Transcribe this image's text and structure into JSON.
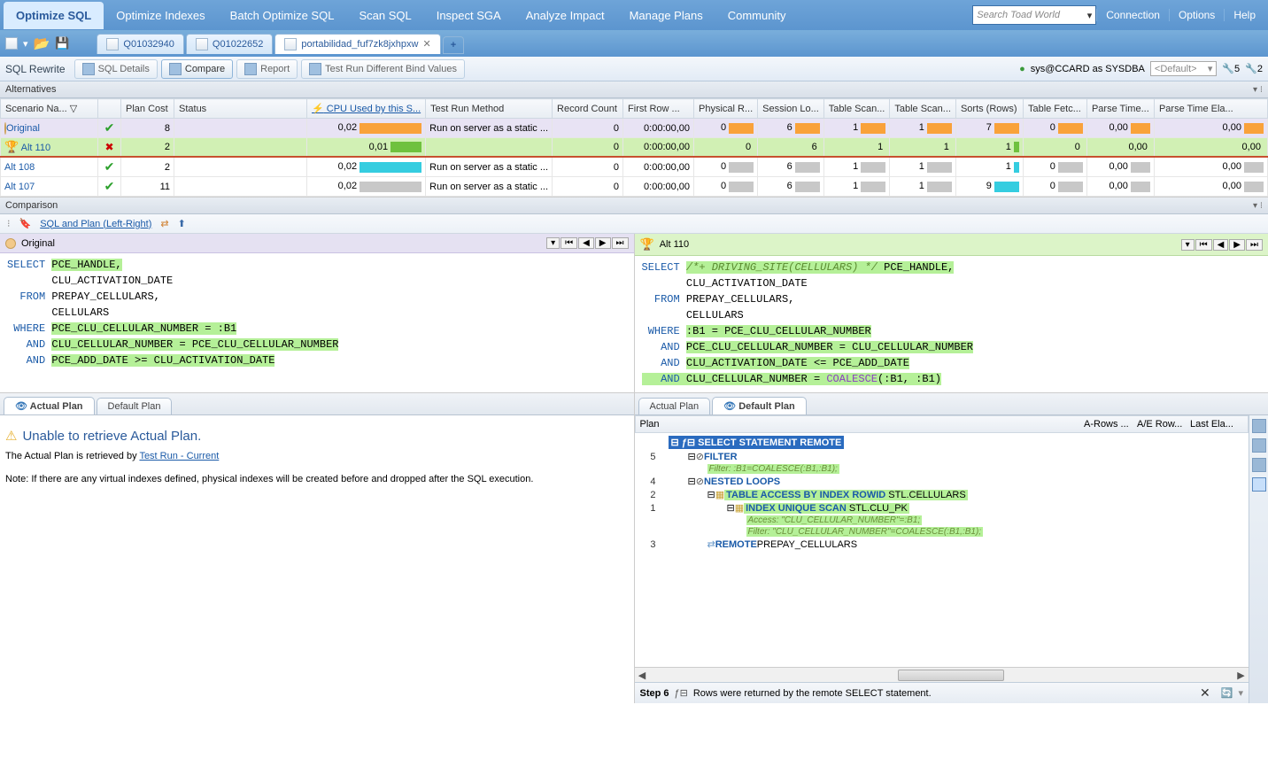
{
  "topMenu": {
    "items": [
      "Optimize SQL",
      "Optimize Indexes",
      "Batch Optimize SQL",
      "Scan SQL",
      "Inspect SGA",
      "Analyze Impact",
      "Manage Plans",
      "Community"
    ],
    "activeIndex": 0,
    "searchPlaceholder": "Search Toad World",
    "rightLinks": [
      "Connection",
      "Options",
      "Help"
    ]
  },
  "docTabs": {
    "tabs": [
      {
        "label": "Q01032940",
        "active": false
      },
      {
        "label": "Q01022652",
        "active": false
      },
      {
        "label": "portabilidad_fuf7zk8jxhpxw",
        "active": true
      }
    ]
  },
  "secondBar": {
    "title": "SQL Rewrite",
    "buttons": [
      {
        "label": "SQL Details",
        "active": false
      },
      {
        "label": "Compare",
        "active": true
      },
      {
        "label": "Report",
        "active": false
      },
      {
        "label": "Test Run Different Bind Values",
        "active": false
      }
    ],
    "connection": "sys@CCARD as SYSDBA",
    "defaultLabel": "<Default>",
    "counters": [
      {
        "v": "5"
      },
      {
        "v": "2"
      }
    ]
  },
  "alternatives": {
    "title": "Alternatives",
    "columns": [
      "Scenario Na... ▽",
      "",
      "Plan Cost",
      "Status",
      "CPU Used by this S...",
      "Test Run Method",
      "Record Count",
      "First Row ...",
      "Physical R...",
      "Session Lo...",
      "Table Scan...",
      "Table Scan...",
      "Sorts (Rows)",
      "Table Fetc...",
      "Parse Time...",
      "Parse Time Ela..."
    ],
    "sortCol": 4,
    "rows": [
      {
        "icon": "person",
        "name": "Original",
        "status": "ok",
        "cost": "8",
        "cpu": "0,02",
        "cpuBar": "orange",
        "cpuW": 70,
        "method": "Run on server as a static ...",
        "rec": "0",
        "first": "0:00:00,00",
        "phys": "0",
        "physBar": "orange",
        "physW": 28,
        "sess": "6",
        "sessBar": "orange",
        "sessW": 28,
        "ts1": "1",
        "ts1Bar": "orange",
        "ts1W": 28,
        "ts2": "1",
        "ts2Bar": "orange",
        "ts2W": 28,
        "sorts": "7",
        "sortsBar": "orange",
        "sortsW": 28,
        "fetch": "0",
        "fetchBar": "orange",
        "fetchW": 28,
        "pt1": "0,00",
        "pt1Bar": "orange",
        "pt1W": 22,
        "pt2": "0,00",
        "pt2Bar": "orange",
        "pt2W": 22,
        "cls": "highlight-purple"
      },
      {
        "icon": "trophy",
        "name": "Alt 110",
        "status": "x",
        "cost": "2",
        "cpu": "0,01",
        "cpuBar": "green",
        "cpuW": 35,
        "method": "",
        "rec": "0",
        "first": "0:00:00,00",
        "phys": "0",
        "physBar": "",
        "physW": 0,
        "sess": "6",
        "sessBar": "",
        "sessW": 0,
        "ts1": "1",
        "ts1Bar": "",
        "ts1W": 0,
        "ts2": "1",
        "ts2Bar": "",
        "ts2W": 0,
        "sorts": "1",
        "sortsBar": "green",
        "sortsW": 6,
        "fetch": "0",
        "fetchBar": "",
        "fetchW": 0,
        "pt1": "0,00",
        "pt1Bar": "",
        "pt1W": 0,
        "pt2": "0,00",
        "pt2Bar": "",
        "pt2W": 0,
        "cls": "highlight-green sel-line"
      },
      {
        "icon": "",
        "name": "Alt 108",
        "status": "ok",
        "cost": "2",
        "cpu": "0,02",
        "cpuBar": "cyan",
        "cpuW": 70,
        "method": "Run on server as a static ...",
        "rec": "0",
        "first": "0:00:00,00",
        "phys": "0",
        "physBar": "gray",
        "physW": 28,
        "sess": "6",
        "sessBar": "gray",
        "sessW": 28,
        "ts1": "1",
        "ts1Bar": "gray",
        "ts1W": 28,
        "ts2": "1",
        "ts2Bar": "gray",
        "ts2W": 28,
        "sorts": "1",
        "sortsBar": "cyan",
        "sortsW": 6,
        "fetch": "0",
        "fetchBar": "gray",
        "fetchW": 28,
        "pt1": "0,00",
        "pt1Bar": "gray",
        "pt1W": 22,
        "pt2": "0,00",
        "pt2Bar": "gray",
        "pt2W": 22,
        "cls": ""
      },
      {
        "icon": "",
        "name": "Alt 107",
        "status": "ok",
        "cost": "11",
        "cpu": "0,02",
        "cpuBar": "gray",
        "cpuW": 70,
        "method": "Run on server as a static ...",
        "rec": "0",
        "first": "0:00:00,00",
        "phys": "0",
        "physBar": "gray",
        "physW": 28,
        "sess": "6",
        "sessBar": "gray",
        "sessW": 28,
        "ts1": "1",
        "ts1Bar": "gray",
        "ts1W": 28,
        "ts2": "1",
        "ts2Bar": "gray",
        "ts2W": 28,
        "sorts": "9",
        "sortsBar": "cyan",
        "sortsW": 28,
        "fetch": "0",
        "fetchBar": "gray",
        "fetchW": 28,
        "pt1": "0,00",
        "pt1Bar": "gray",
        "pt1W": 22,
        "pt2": "0,00",
        "pt2Bar": "gray",
        "pt2W": 22,
        "cls": ""
      }
    ]
  },
  "comparison": {
    "title": "Comparison",
    "toolbarLink": "SQL and Plan (Left-Right)",
    "left": {
      "title": "Original",
      "sql": {
        "l1p1": "SELECT ",
        "l1hl": "PCE_HANDLE,",
        "l2": "       CLU_ACTIVATION_DATE",
        "l3": "  FROM PREPAY_CELLULARS,",
        "l4": "       CELLULARS",
        "l5w": " WHERE ",
        "l5hl": "PCE_CLU_CELLULAR_NUMBER = :B1",
        "l6a": "   AND ",
        "l6hl": "CLU_CELLULAR_NUMBER = PCE_CLU_CELLULAR_NUMBER",
        "l7a": "   AND ",
        "l7hl": "PCE_ADD_DATE >= CLU_ACTIVATION_DATE"
      }
    },
    "right": {
      "title": "Alt 110",
      "sql": {
        "l1p1": "SELECT ",
        "l1c": "/*+ DRIVING_SITE(CELLULARS) */",
        "l1hl": " PCE_HANDLE,",
        "l2": "       CLU_ACTIVATION_DATE",
        "l3": "  FROM PREPAY_CELLULARS,",
        "l4": "       CELLULARS",
        "l5w": " WHERE ",
        "l5hl": ":B1 = PCE_CLU_CELLULAR_NUMBER",
        "l6a": "   AND ",
        "l6hl": "PCE_CLU_CELLULAR_NUMBER = CLU_CELLULAR_NUMBER",
        "l7a": "   AND ",
        "l7hl": "CLU_ACTIVATION_DATE <= PCE_ADD_DATE",
        "l8a": "   AND ",
        "l8t": "CLU_CELLULAR_NUMBER = ",
        "l8f": "COALESCE",
        "l8r": "(:B1, :B1)"
      }
    }
  },
  "plans": {
    "left": {
      "tabs": [
        "Actual Plan",
        "Default Plan"
      ],
      "activeTab": 0,
      "warning": "Unable to retrieve Actual Plan.",
      "line1a": "The Actual Plan is retrieved by ",
      "line1link": "Test Run - Current",
      "line2": "Note: If there are any virtual indexes defined, physical indexes will be created before and dropped after the SQL execution."
    },
    "right": {
      "tabs": [
        "Actual Plan",
        "Default Plan"
      ],
      "activeTab": 1,
      "headCols": [
        "Plan",
        "A-Rows ...",
        "A/E Row...",
        "Last Ela..."
      ],
      "tree": [
        {
          "n": "",
          "ind": 0,
          "type": "sel",
          "text": "SELECT STATEMENT REMOTE"
        },
        {
          "n": "5",
          "ind": 1,
          "type": "bold",
          "text": "FILTER"
        },
        {
          "n": "",
          "ind": 2,
          "type": "annot",
          "text": "Filter: :B1=COALESCE(:B1,:B1);"
        },
        {
          "n": "4",
          "ind": 1,
          "type": "bold",
          "text": "NESTED LOOPS"
        },
        {
          "n": "2",
          "ind": 2,
          "type": "green",
          "bold": "TABLE ACCESS BY INDEX ROWID",
          "rest": " STL.CELLULARS"
        },
        {
          "n": "1",
          "ind": 3,
          "type": "green",
          "bold": "INDEX UNIQUE SCAN",
          "rest": " STL.CLU_PK"
        },
        {
          "n": "",
          "ind": 4,
          "type": "annot",
          "text": "Access: \"CLU_CELLULAR_NUMBER\"=:B1;"
        },
        {
          "n": "",
          "ind": 4,
          "type": "annot",
          "text": "Filter: \"CLU_CELLULAR_NUMBER\"=COALESCE(:B1,:B1);"
        },
        {
          "n": "3",
          "ind": 2,
          "type": "plain",
          "bold": "REMOTE",
          "rest": " PREPAY_CELLULARS"
        }
      ],
      "footer": {
        "step": "Step 6",
        "text": "Rows were returned by the remote SELECT statement."
      }
    }
  }
}
